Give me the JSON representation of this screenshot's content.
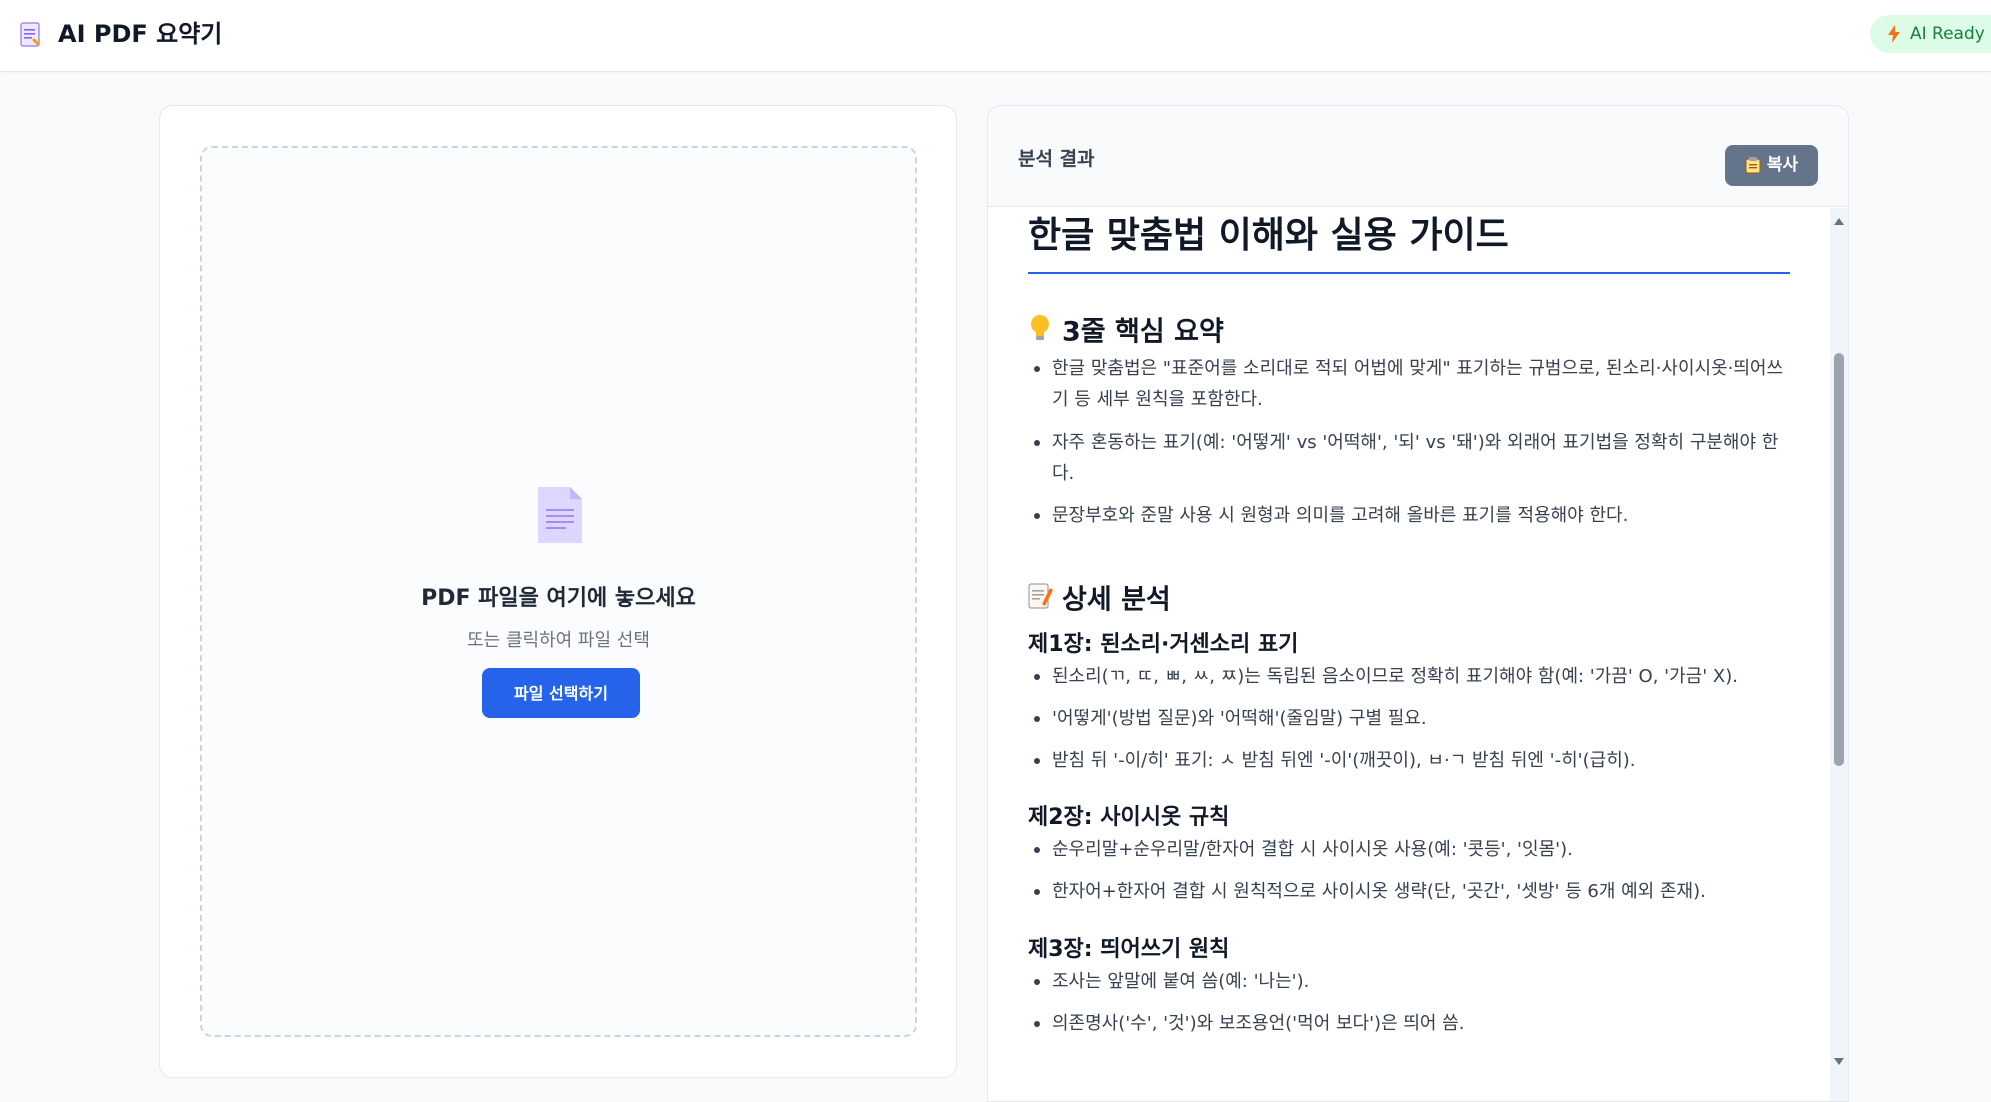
{
  "header": {
    "title": "AI PDF 요약기",
    "status": "AI Ready",
    "logo_icon": "document-icon",
    "status_icon": "lightning-icon"
  },
  "upload": {
    "icon": "file-icon",
    "title": "PDF 파일을 여기에 놓으세요",
    "subtitle": "또는 클릭하여 파일 선택",
    "button_label": "파일 선택하기"
  },
  "result": {
    "label": "분석 결과",
    "copy_label": "복사",
    "copy_icon": "clipboard-icon",
    "doc_title": "한글 맞춤법 이해와 실용 가이드",
    "summary_heading": "3줄 핵심 요약",
    "summary_emoji": "lightbulb-icon",
    "summary_items": [
      "한글 맞춤법은 \"표준어를 소리대로 적되 어법에 맞게\" 표기하는 규범으로, 된소리·사이시옷·띄어쓰기 등 세부 원칙을 포함한다.",
      "자주 혼동하는 표기(예: '어떻게' vs '어떡해', '되' vs '돼')와 외래어 표기법을 정확히 구분해야 한다.",
      "문장부호와 준말 사용 시 원형과 의미를 고려해 올바른 표기를 적용해야 한다."
    ],
    "detail_heading": "상세 분석",
    "detail_emoji": "memo-icon",
    "chapters": [
      {
        "title": "제1장: 된소리·거센소리 표기",
        "items": [
          "된소리(ㄲ, ㄸ, ㅃ, ㅆ, ㅉ)는 독립된 음소이므로 정확히 표기해야 함(예: '가끔' O, '가금' X).",
          "'어떻게'(방법 질문)와 '어떡해'(줄임말) 구별 필요.",
          "받침 뒤 '-이/히' 표기: ㅅ 받침 뒤엔 '-이'(깨끗이), ㅂ·ㄱ 받침 뒤엔 '-히'(급히)."
        ]
      },
      {
        "title": "제2장: 사이시옷 규칙",
        "items": [
          "순우리말+순우리말/한자어 결합 시 사이시옷 사용(예: '콧등', '잇몸').",
          "한자어+한자어 결합 시 원칙적으로 사이시옷 생략(단, '곳간', '셋방' 등 6개 예외 존재)."
        ]
      },
      {
        "title": "제3장: 띄어쓰기 원칙",
        "items": [
          "조사는 앞말에 붙여 씀(예: '나는').",
          "의존명사('수', '것')와 보조용언('먹어 보다')은 띄어 씀."
        ]
      }
    ]
  }
}
